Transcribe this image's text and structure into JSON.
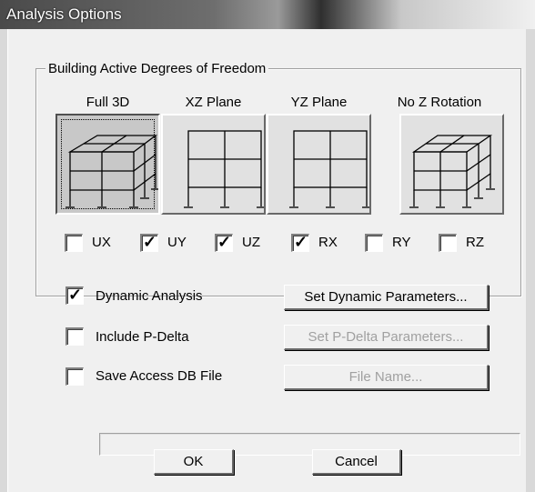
{
  "window": {
    "title": "Analysis Options"
  },
  "dof_group": {
    "legend": "Building Active Degrees of Freedom",
    "options": [
      {
        "label": "Full 3D",
        "selected": true,
        "icon": "frame-3d-icon"
      },
      {
        "label": "XZ Plane",
        "selected": false,
        "icon": "frame-2d-icon"
      },
      {
        "label": "YZ Plane",
        "selected": false,
        "icon": "frame-2d-icon"
      },
      {
        "label": "No Z Rotation",
        "selected": false,
        "icon": "frame-3d-icon"
      }
    ],
    "checkboxes": [
      {
        "label": "UX",
        "checked": false
      },
      {
        "label": "UY",
        "checked": true
      },
      {
        "label": "UZ",
        "checked": true
      },
      {
        "label": "RX",
        "checked": true
      },
      {
        "label": "RY",
        "checked": false
      },
      {
        "label": "RZ",
        "checked": false
      }
    ]
  },
  "dynamic_analysis": {
    "label": "Dynamic Analysis",
    "checked": true,
    "button": "Set Dynamic Parameters..."
  },
  "p_delta": {
    "label": "Include P-Delta",
    "checked": false,
    "button": "Set P-Delta Parameters..."
  },
  "access_db": {
    "label": "Save Access DB File",
    "checked": false,
    "button": "File Name...",
    "path": ""
  },
  "buttons": {
    "ok": "OK",
    "cancel": "Cancel"
  }
}
